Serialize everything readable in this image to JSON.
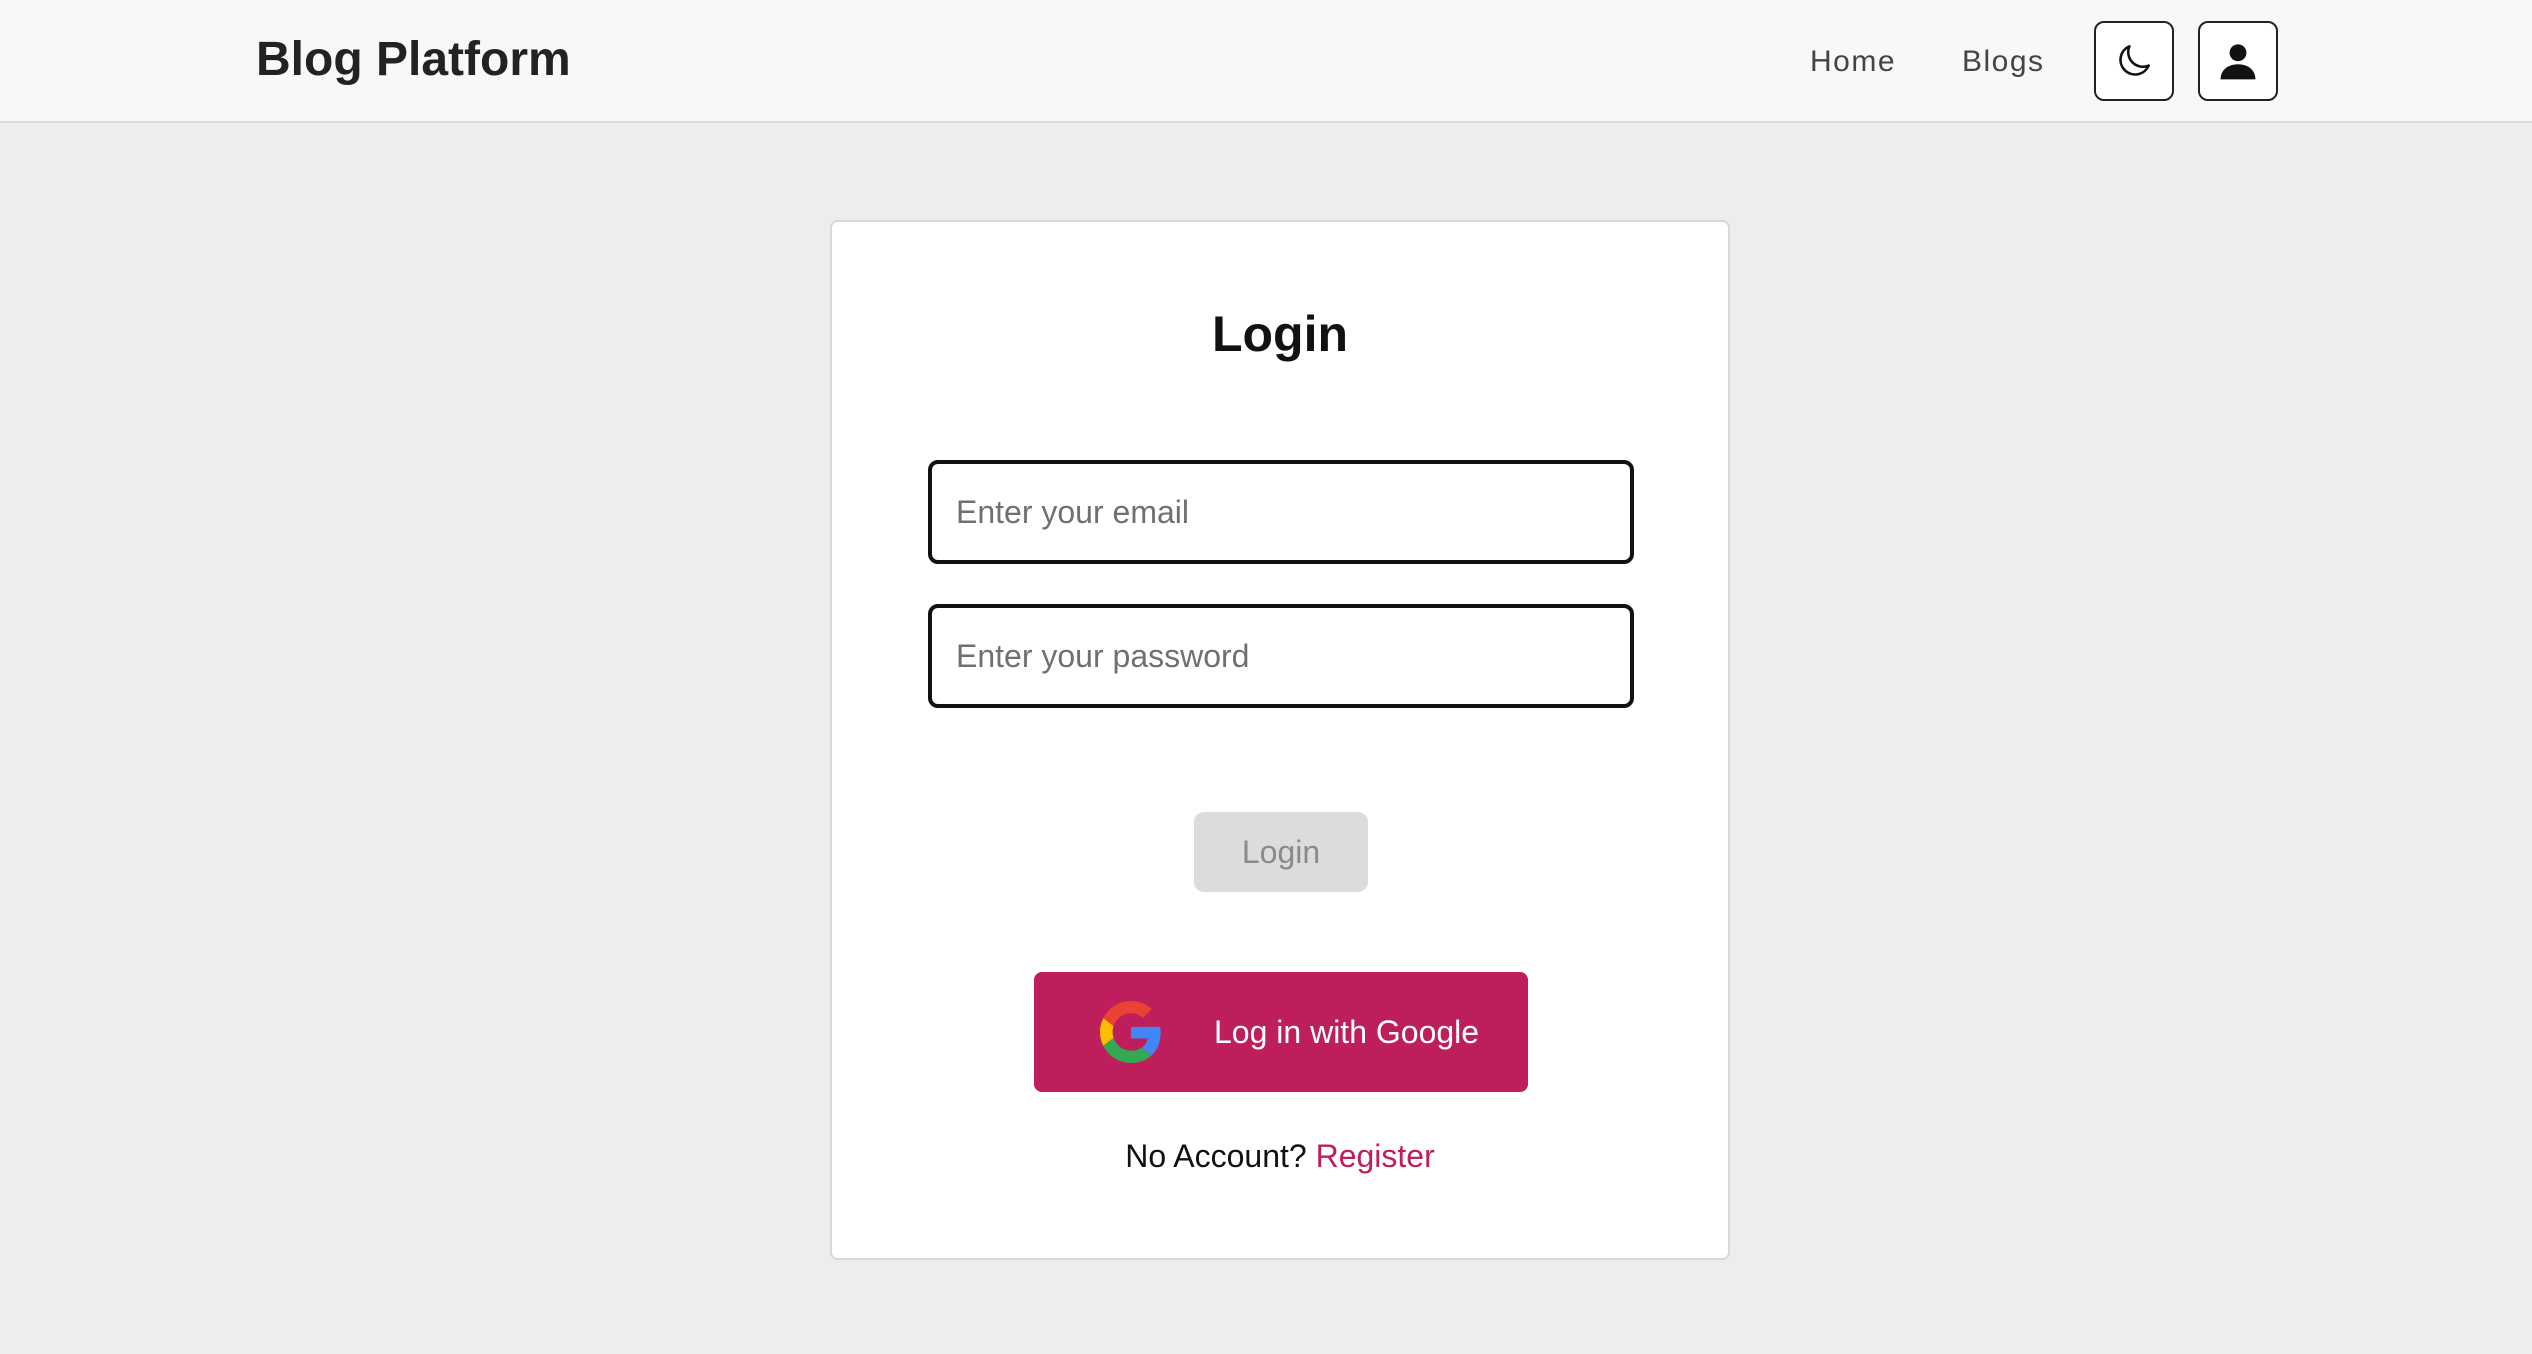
{
  "header": {
    "brand": "Blog Platform",
    "nav": {
      "home": "Home",
      "blogs": "Blogs"
    },
    "theme_toggle_icon": "moon-icon",
    "user_icon": "user-icon"
  },
  "login": {
    "title": "Login",
    "email_placeholder": "Enter your email",
    "email_value": "",
    "password_placeholder": "Enter your password",
    "password_value": "",
    "submit_label": "Login",
    "google_label": "Log in with Google",
    "no_account_text": "No Account?",
    "register_label": "Register"
  },
  "colors": {
    "accent": "#be1e5b",
    "page_background": "#ededed",
    "header_background": "#f8f8f8",
    "disabled_button": "#dcdcdc"
  }
}
